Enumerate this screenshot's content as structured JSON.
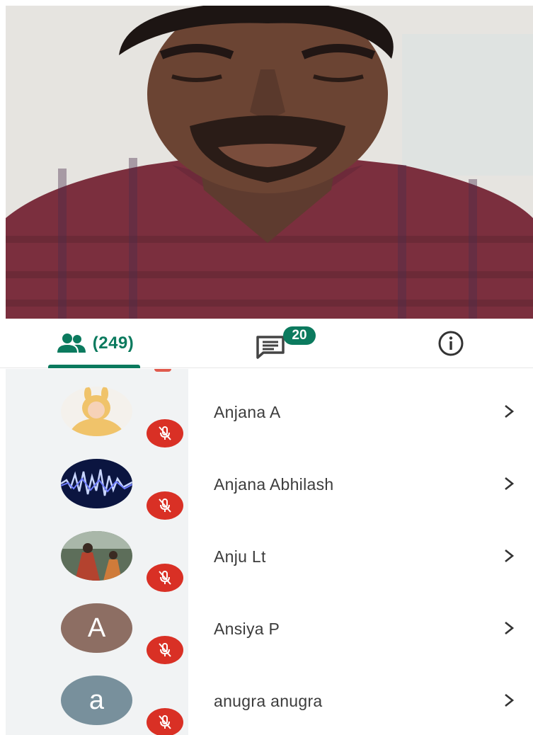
{
  "video": {
    "icon": "participant-video-feed"
  },
  "tabs": {
    "people": {
      "icon": "people-icon",
      "count": "(249)"
    },
    "chat": {
      "icon": "chat-icon",
      "badge": "20"
    },
    "info": {
      "icon": "info-icon"
    }
  },
  "colors": {
    "accent": "#0b7a5e",
    "mute": "#d93025",
    "list_bg": "#f1f3f4"
  },
  "participants": [
    {
      "name": "Anjana A",
      "avatar": "photo-baby",
      "muted": true
    },
    {
      "name": "Anjana Abhilash",
      "avatar": "photo-blue-waves",
      "muted": true
    },
    {
      "name": "Anju Lt",
      "avatar": "photo-outdoor",
      "muted": true
    },
    {
      "name": "Ansiya P",
      "avatar_letter": "A",
      "avatar_color": "#8d6e63",
      "muted": true
    },
    {
      "name": "anugra anugra",
      "avatar_letter": "a",
      "avatar_color": "#78909c",
      "muted": true
    }
  ]
}
